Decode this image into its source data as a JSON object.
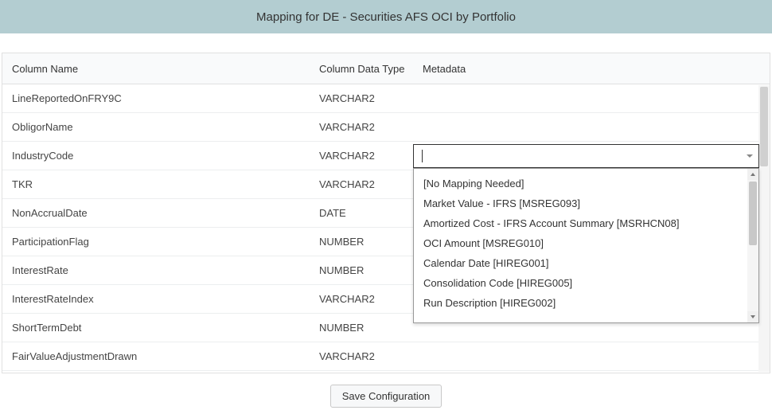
{
  "title": "Mapping for DE - Securities AFS OCI by Portfolio",
  "columns": {
    "name": "Column Name",
    "dataType": "Column Data Type",
    "metadata": "Metadata"
  },
  "rows": [
    {
      "name": "LineReportedOnFRY9C",
      "type": "VARCHAR2"
    },
    {
      "name": "ObligorName",
      "type": "VARCHAR2"
    },
    {
      "name": "IndustryCode",
      "type": "VARCHAR2"
    },
    {
      "name": "TKR",
      "type": "VARCHAR2"
    },
    {
      "name": "NonAccrualDate",
      "type": "DATE"
    },
    {
      "name": "ParticipationFlag",
      "type": "NUMBER"
    },
    {
      "name": "InterestRate",
      "type": "NUMBER"
    },
    {
      "name": "InterestRateIndex",
      "type": "VARCHAR2"
    },
    {
      "name": "ShortTermDebt",
      "type": "NUMBER"
    },
    {
      "name": "FairValueAdjustmentDrawn",
      "type": "VARCHAR2"
    }
  ],
  "dropdown": {
    "options": [
      "[No Mapping Needed]",
      "Market Value - IFRS [MSREG093]",
      "Amortized Cost - IFRS Account Summary [MSRHCN08]",
      "OCI Amount [MSREG010]",
      "Calendar Date [HIREG001]",
      "Consolidation Code [HIREG005]",
      "Run Description [HIREG002]"
    ]
  },
  "footer": {
    "save_label": "Save Configuration"
  }
}
